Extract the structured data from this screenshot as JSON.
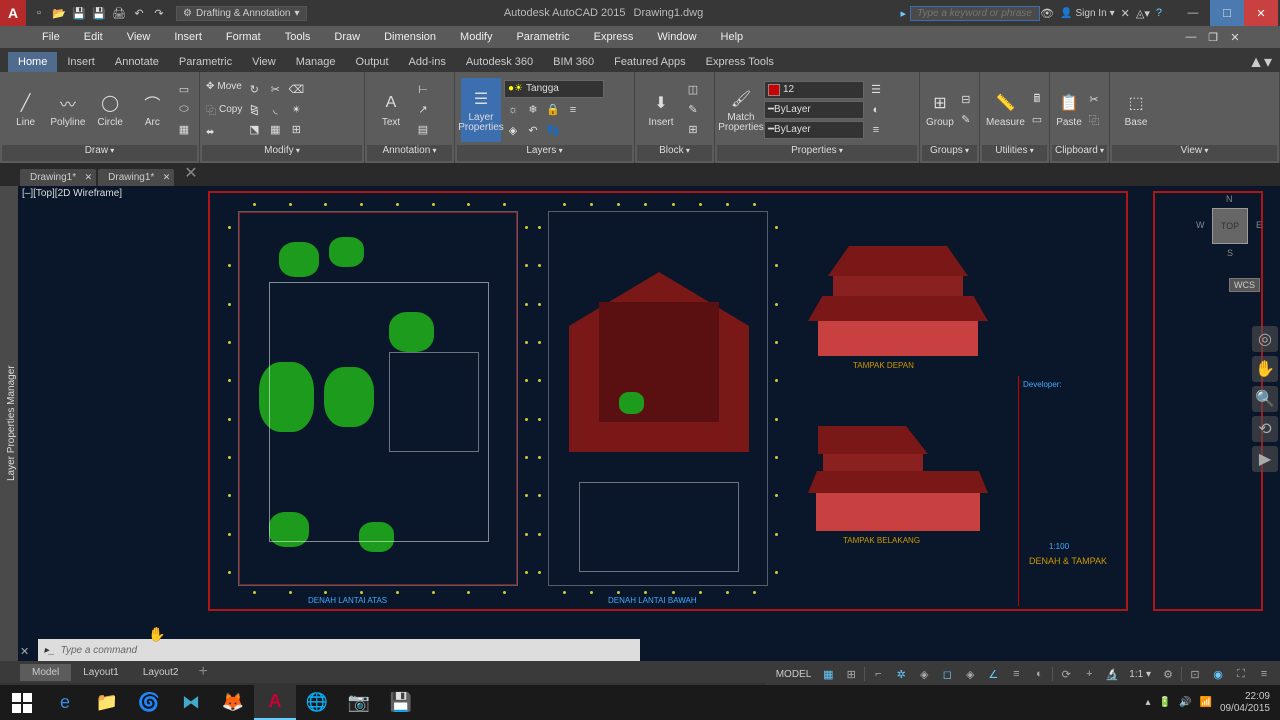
{
  "title": {
    "app": "Autodesk AutoCAD 2015",
    "doc": "Drawing1.dwg"
  },
  "workspace": "Drafting & Annotation",
  "search_placeholder": "Type a keyword or phrase",
  "signin": "Sign In",
  "menus": [
    "File",
    "Edit",
    "View",
    "Insert",
    "Format",
    "Tools",
    "Draw",
    "Dimension",
    "Modify",
    "Parametric",
    "Express",
    "Window",
    "Help"
  ],
  "ribbon_tabs": [
    "Home",
    "Insert",
    "Annotate",
    "Parametric",
    "View",
    "Manage",
    "Output",
    "Add-ins",
    "Autodesk 360",
    "BIM 360",
    "Featured Apps",
    "Express Tools"
  ],
  "active_ribbon": "Home",
  "panels": {
    "draw": {
      "label": "Draw",
      "items": [
        "Line",
        "Polyline",
        "Circle",
        "Arc"
      ]
    },
    "modify": {
      "label": "Modify",
      "move": "Move",
      "copy": "Copy"
    },
    "annotation": {
      "label": "Annotation",
      "text": "Text"
    },
    "layers": {
      "label": "Layers",
      "btn": "Layer Properties",
      "current": "Tangga"
    },
    "block": {
      "label": "Block",
      "btn": "Insert"
    },
    "properties": {
      "label": "Properties",
      "match": "Match Properties",
      "layer_num": "12",
      "line1": "ByLayer",
      "line2": "ByLayer"
    },
    "groups": {
      "label": "Groups",
      "btn": "Group"
    },
    "utilities": {
      "label": "Utilities",
      "btn": "Measure"
    },
    "clipboard": {
      "label": "Clipboard",
      "btn": "Paste"
    },
    "view": {
      "label": "View",
      "btn": "Base"
    }
  },
  "doc_tabs": [
    "Drawing1*",
    "Drawing1*"
  ],
  "viewport_label": "[–][Top][2D Wireframe]",
  "side_panel": "Layer Properties Manager",
  "viewcube": {
    "face": "TOP",
    "n": "N",
    "s": "S",
    "e": "E",
    "w": "W",
    "wcs": "WCS"
  },
  "cmd_placeholder": "Type a command",
  "layout_tabs": [
    "Model",
    "Layout1",
    "Layout2"
  ],
  "statusbar": {
    "model": "MODEL",
    "scale": "1:1"
  },
  "drawing_labels": {
    "plan1": "DENAH LANTAI ATAS",
    "plan2": "DENAH LANTAI BAWAH",
    "elev1": "TAMPAK DEPAN",
    "elev2": "TAMPAK BELAKANG",
    "sheet": "DENAH & TAMPAK",
    "scale": "1:100",
    "dev": "Developer:"
  },
  "tray": {
    "time": "22:09",
    "date": "09/04/2015"
  }
}
